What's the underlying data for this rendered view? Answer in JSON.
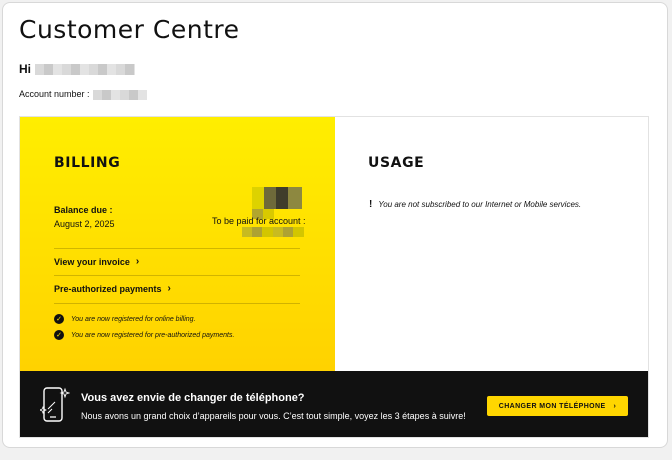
{
  "page": {
    "title": "Customer Centre",
    "greeting": "Hi",
    "account_label": "Account number :"
  },
  "billing": {
    "title": "BILLING",
    "balance_label": "Balance due :",
    "balance_date": "August 2, 2025",
    "to_be_paid_label": "To be paid for account :",
    "view_invoice": "View your invoice",
    "preauth_payments": "Pre-authorized payments",
    "notices": [
      "You are now registered for online billing.",
      "You are now registered for pre-authorized payments."
    ],
    "background_color": "#ffe600"
  },
  "usage": {
    "title": "USAGE",
    "message": "You are not subscribed to our Internet or Mobile services."
  },
  "promo": {
    "title": "Vous avez envie de changer de téléphone?",
    "text": "Nous avons un grand choix d’appareils pour vous. C’est tout simple, voyez les 3 étapes à suivre!",
    "cta_label": "CHANGER MON TÉLÉPHONE",
    "cta_color": "#ffd600",
    "icon": "phone-sparkle-icon"
  },
  "icons": {
    "chevron": "›",
    "check": "✓",
    "exclamation": "!"
  }
}
